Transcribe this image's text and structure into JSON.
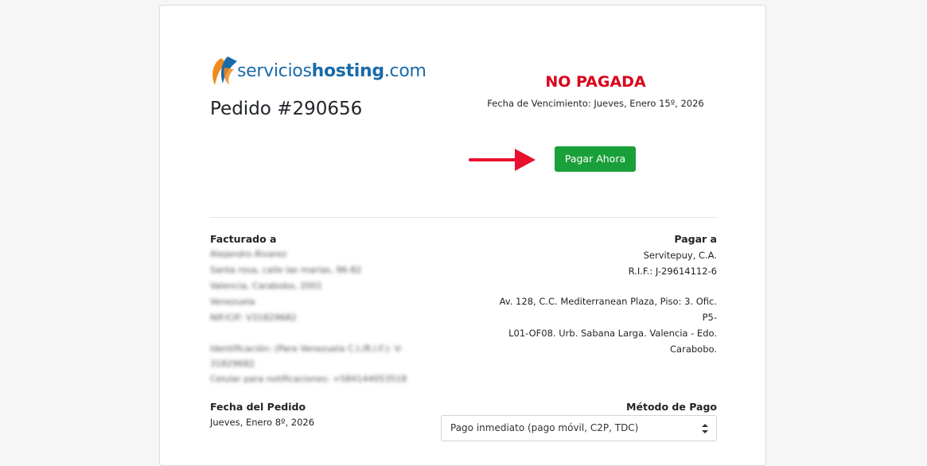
{
  "logo": {
    "part1": "servicios",
    "part2": "hosting",
    "part3": ".com"
  },
  "order": {
    "title": "Pedido #290656",
    "status": "NO PAGADA",
    "due_date": "Fecha de Vencimiento: Jueves, Enero 15º, 2026",
    "pay_button": "Pagar Ahora"
  },
  "billed_to": {
    "heading": "Facturado a",
    "lines": [
      "Alejandro Álvarez",
      "Santa rosa, calle las marias, 96-82",
      "Valencia, Carabobo, 2001",
      "Venezuela",
      "NIF/CIF: V31829682",
      "Identificación: (Para Venezuela C.I./R.I.F.): V-",
      "31829682",
      "Celular para notificaciones: +584144053518"
    ]
  },
  "pay_to": {
    "heading": "Pagar a",
    "company": "Servitepuy, C.A.",
    "rif": "R.I.F.: J-29614112-6",
    "address": [
      "Av. 128, C.C. Mediterranean Plaza, Piso: 3. Ofic. P5-",
      "L01-OF08. Urb. Sabana Larga. Valencia - Edo.",
      "Carabobo."
    ]
  },
  "order_date": {
    "heading": "Fecha del Pedido",
    "value": "Jueves, Enero 8º, 2026"
  },
  "payment_method": {
    "heading": "Método de Pago",
    "selected": "Pago inmediato (pago móvil, C2P, TDC)"
  },
  "colors": {
    "status": "#d9001a",
    "pay_button": "#1aa03a",
    "arrow": "#e8102e"
  }
}
